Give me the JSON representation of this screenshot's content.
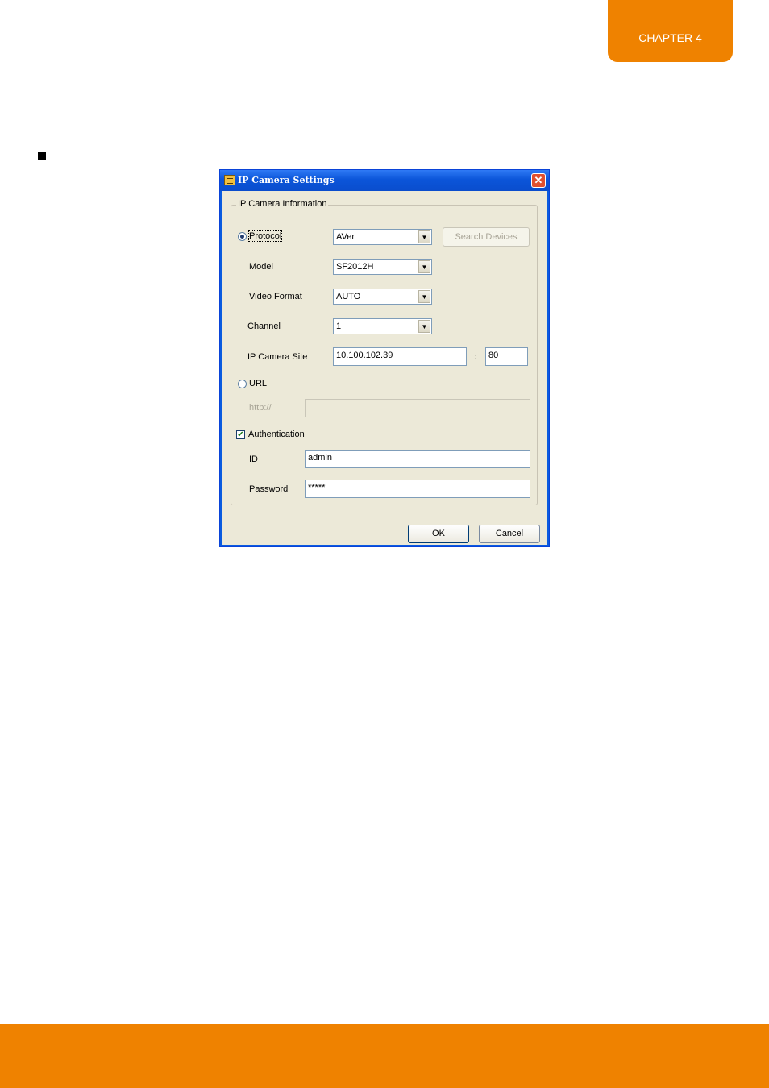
{
  "page": {
    "chapter": "CHAPTER 4",
    "accent_color": "#ef8200"
  },
  "dialog": {
    "title": "IP Camera Settings",
    "close_glyph": "✕",
    "group_title": "IP Camera Information",
    "protocol": {
      "label": "Protocol",
      "value": "AVer",
      "selected": true
    },
    "search_button": "Search Devices",
    "model": {
      "label": "Model",
      "value": "SF2012H"
    },
    "video_format": {
      "label": "Video Format",
      "value": "AUTO"
    },
    "channel": {
      "label": "Channel",
      "value": "1"
    },
    "ip_site": {
      "label": "IP Camera Site",
      "address": "10.100.102.39",
      "separator": ":",
      "port": "80"
    },
    "url": {
      "label": "URL",
      "selected": false,
      "prefix": "http://",
      "value": ""
    },
    "authentication": {
      "label": "Authentication",
      "checked": true,
      "check_glyph": "✔"
    },
    "id": {
      "label": "ID",
      "value": "admin"
    },
    "password": {
      "label": "Password",
      "value": "*****"
    },
    "ok_button": "OK",
    "cancel_button": "Cancel",
    "arrow_glyph": "▼"
  }
}
